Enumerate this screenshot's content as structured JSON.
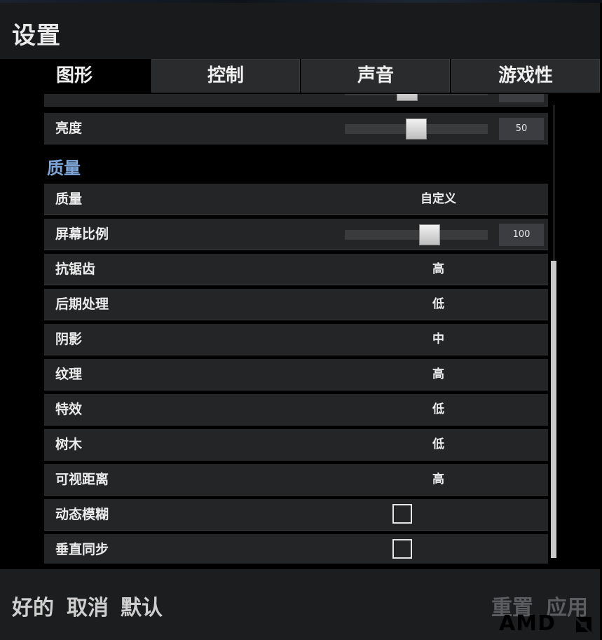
{
  "window": {
    "title": "设置"
  },
  "tabs": [
    {
      "label": "图形",
      "active": true
    },
    {
      "label": "控制",
      "active": false
    },
    {
      "label": "声音",
      "active": false
    },
    {
      "label": "游戏性",
      "active": false
    }
  ],
  "brightness": {
    "label": "亮度",
    "value": "50",
    "fraction": 0.5
  },
  "section": {
    "title": "质量"
  },
  "quality_rows": {
    "quality": {
      "label": "质量",
      "value": "自定义"
    },
    "screen_scale": {
      "label": "屏幕比例",
      "value": "100",
      "fraction": 0.6
    },
    "anti_aliasing": {
      "label": "抗锯齿",
      "value": "高"
    },
    "post_processing": {
      "label": "后期处理",
      "value": "低"
    },
    "shadows": {
      "label": "阴影",
      "value": "中"
    },
    "textures": {
      "label": "纹理",
      "value": "高"
    },
    "effects": {
      "label": "特效",
      "value": "低"
    },
    "foliage": {
      "label": "树木",
      "value": "低"
    },
    "view_distance": {
      "label": "可视距离",
      "value": "高"
    },
    "motion_blur": {
      "label": "动态模糊",
      "checked": false
    },
    "vsync": {
      "label": "垂直同步",
      "checked": false
    }
  },
  "footer": {
    "ok": "好的",
    "cancel": "取消",
    "default": "默认",
    "reset": "重置",
    "apply": "应用"
  },
  "watermark": {
    "text": "AMD"
  },
  "colors": {
    "section_title": "#7fa6d9",
    "row_bg": "#242527",
    "footer_bg": "#1c1d1f"
  }
}
